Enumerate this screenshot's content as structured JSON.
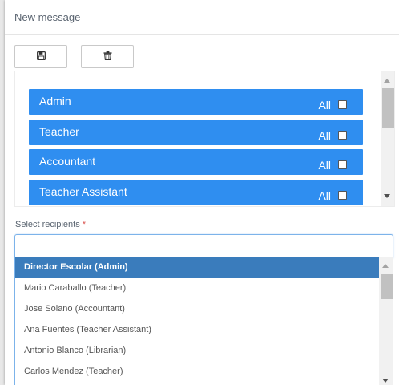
{
  "modal": {
    "title": "New message"
  },
  "toolbar": {
    "save_icon": "floppy-disk-icon",
    "delete_icon": "trash-icon"
  },
  "groups": [
    {
      "label": "Admin",
      "all_label": "All",
      "checked": false
    },
    {
      "label": "Teacher",
      "all_label": "All",
      "checked": false
    },
    {
      "label": "Accountant",
      "all_label": "All",
      "checked": false
    },
    {
      "label": "Teacher Assistant",
      "all_label": "All",
      "checked": false
    }
  ],
  "recipients": {
    "label": "Select recipients",
    "required_mark": "*",
    "search_value": "",
    "options": [
      {
        "label": "Director Escolar (Admin)",
        "selected": true
      },
      {
        "label": "Mario Caraballo (Teacher)",
        "selected": false
      },
      {
        "label": "Jose Solano (Accountant)",
        "selected": false
      },
      {
        "label": "Ana Fuentes (Teacher Assistant)",
        "selected": false
      },
      {
        "label": "Antonio Blanco (Librarian)",
        "selected": false
      },
      {
        "label": "Carlos Mendez (Teacher)",
        "selected": false
      }
    ]
  },
  "colors": {
    "group_bg": "#2f8ef0",
    "selected_option_bg": "#3a7cbc",
    "required": "#d9534f",
    "focus_border": "#7cb3ea"
  }
}
